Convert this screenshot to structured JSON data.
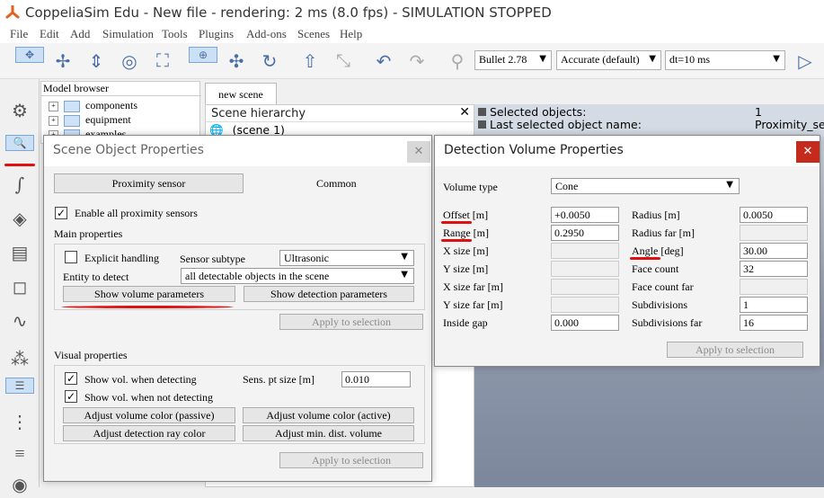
{
  "window": {
    "title": "CoppeliaSim Edu - New file - rendering: 2 ms (8.0 fps) - SIMULATION STOPPED"
  },
  "menu": [
    "File",
    "Edit",
    "Add",
    "Simulation",
    "Tools",
    "Plugins",
    "Add-ons",
    "Scenes",
    "Help"
  ],
  "toolbar": {
    "engine": "Bullet 2.78",
    "accuracy": "Accurate (default)",
    "dt": "dt=10 ms"
  },
  "model_browser": {
    "header": "Model browser",
    "items": [
      "components",
      "equipment",
      "examples"
    ]
  },
  "scene_tab": "new scene",
  "hierarchy": {
    "header": "Scene hierarchy",
    "root": "(scene 1)"
  },
  "info": {
    "rows": [
      {
        "k": "Selected objects:",
        "v": "1"
      },
      {
        "k": "Last selected object name:",
        "v": "Proximity_ser"
      }
    ]
  },
  "sop": {
    "title": "Scene Object Properties",
    "tab_proximity": "Proximity sensor",
    "tab_common": "Common",
    "enable_all": "Enable all proximity sensors",
    "main_properties": "Main properties",
    "explicit_handling": "Explicit handling",
    "sensor_subtype_label": "Sensor subtype",
    "sensor_subtype": "Ultrasonic",
    "entity_label": "Entity to detect",
    "entity": "all detectable objects in the scene",
    "show_volume": "Show volume parameters",
    "show_detection": "Show detection parameters",
    "apply": "Apply to selection",
    "visual_properties": "Visual properties",
    "show_vol_detecting": "Show vol. when detecting",
    "show_vol_not_detecting": "Show vol. when not detecting",
    "pt_size_label": "Sens. pt size [m]",
    "pt_size": "0.010",
    "adj_passive": "Adjust volume color (passive)",
    "adj_active": "Adjust volume color (active)",
    "adj_ray": "Adjust detection ray color",
    "adj_min": "Adjust min. dist. volume",
    "apply2": "Apply to selection"
  },
  "dvp": {
    "title": "Detection Volume Properties",
    "volume_type_label": "Volume type",
    "volume_type": "Cone",
    "left": [
      {
        "label": "Offset [m]",
        "value": "+0.0050"
      },
      {
        "label": "Range [m]",
        "value": "0.2950"
      },
      {
        "label": "X size [m]",
        "value": ""
      },
      {
        "label": "Y size [m]",
        "value": ""
      },
      {
        "label": "X size far [m]",
        "value": ""
      },
      {
        "label": "Y size far [m]",
        "value": ""
      },
      {
        "label": "Inside gap",
        "value": "0.000"
      }
    ],
    "right": [
      {
        "label": "Radius [m]",
        "value": "0.0050"
      },
      {
        "label": "Radius far [m]",
        "value": ""
      },
      {
        "label": "Angle [deg]",
        "value": "30.00"
      },
      {
        "label": "Face count",
        "value": "32"
      },
      {
        "label": "Face count far",
        "value": ""
      },
      {
        "label": "Subdivisions",
        "value": "1"
      },
      {
        "label": "Subdivisions far",
        "value": "16"
      }
    ],
    "apply": "Apply to selection"
  }
}
